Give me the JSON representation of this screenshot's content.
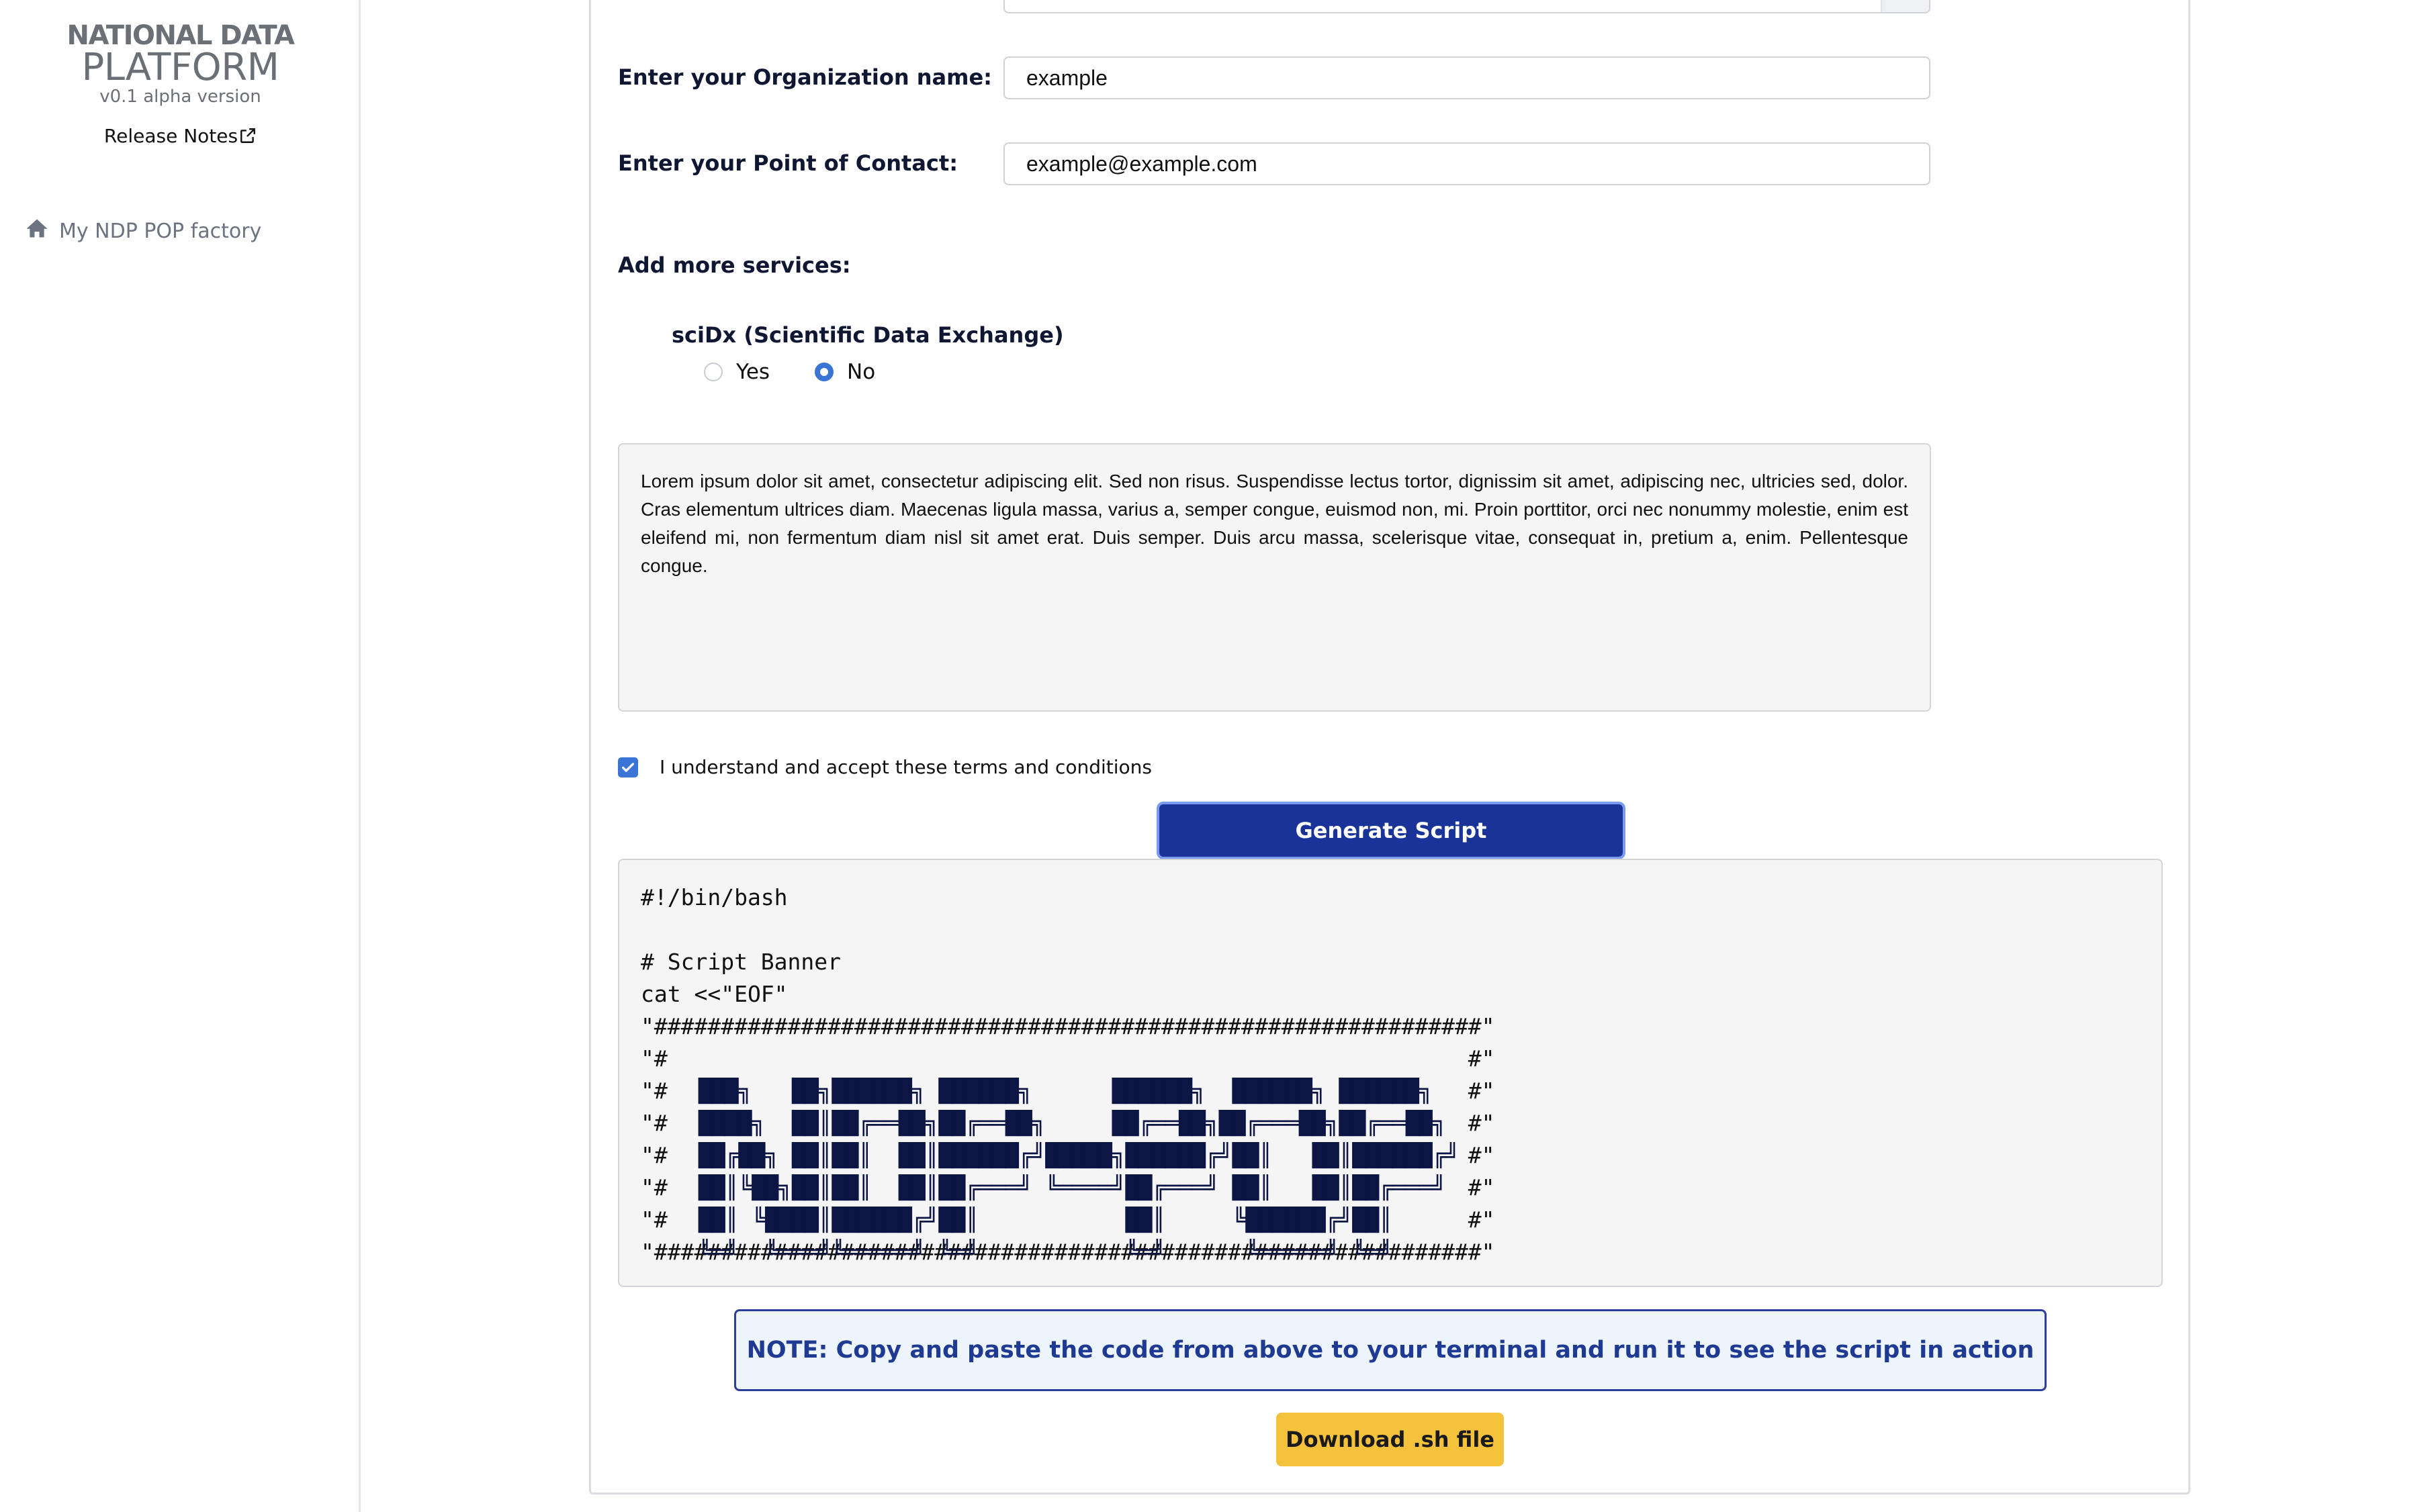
{
  "sidebar": {
    "logo": {
      "line1": "NATIONAL DATA",
      "line2": "PLATFORM",
      "version": "v0.1 alpha version"
    },
    "release_notes": "Release Notes",
    "nav_items": [
      {
        "label": "My NDP POP factory",
        "icon": "home-icon"
      }
    ]
  },
  "form": {
    "org_label": "Enter your Organization name:",
    "org_value": "example",
    "contact_label": "Enter your Point of Contact:",
    "contact_value": "example@example.com",
    "services_label": "Add more services:",
    "service": {
      "title": "sciDx (Scientific Data Exchange)",
      "options": [
        "Yes",
        "No"
      ],
      "selected": "No"
    },
    "terms_text": "Lorem ipsum dolor sit amet, consectetur adipiscing elit. Sed non risus. Suspendisse lectus tortor, dignissim sit amet, adipiscing nec, ultricies sed, dolor. Cras elementum ultrices diam. Maecenas ligula massa, varius a, semper congue, euismod non, mi. Proin porttitor, orci nec nonummy molestie, enim est eleifend mi, non fermentum diam nisl sit amet erat. Duis semper. Duis arcu massa, scelerisque vitae, consequat in, pretium a, enim. Pellentesque congue.",
    "terms_checkbox_label": "I understand and accept these terms and conditions",
    "terms_checked": true,
    "generate_button": "Generate Script"
  },
  "script": {
    "code_head": "#!/bin/bash\n\n# Script Banner\ncat <<\"EOF\"\n\"##############################################################\"",
    "banner_frame": "\"#                                                            #\"\n\"#                                                            #\"\n\"#                                                            #\"\n\"#                                                            #\"\n\"#                                                            #\"\n\"#                                                            #\"\n\"##############################################################\"",
    "ascii_art": "███╗   ██╗██████╗ ██████╗      ██████╗  ██████╗ ██████╗ \n████╗  ██║██╔══██╗██╔══██╗     ██╔══██╗██╔═══██╗██╔══██╗\n██╔██╗ ██║██║  ██║██████╔╝█████╗██████╔╝██║   ██║██████╔╝\n██║╚██╗██║██║  ██║██╔═══╝ ╚════╝██╔═══╝ ██║   ██║██╔═══╝ \n██║ ╚████║██████╔╝██║           ██║     ╚██████╔╝██║     \n╚═╝  ╚═══╝╚═════╝ ╚═╝           ╚═╝      ╚═════╝ ╚═╝     "
  },
  "note": "NOTE: Copy and paste the code from above to your terminal and run it to see the script in action",
  "download_button": "Download .sh file",
  "colors": {
    "primary_button": "#1a3399",
    "download_button": "#f5c33b",
    "note_border": "#2b3f9a",
    "accent": "#3a74d4"
  }
}
